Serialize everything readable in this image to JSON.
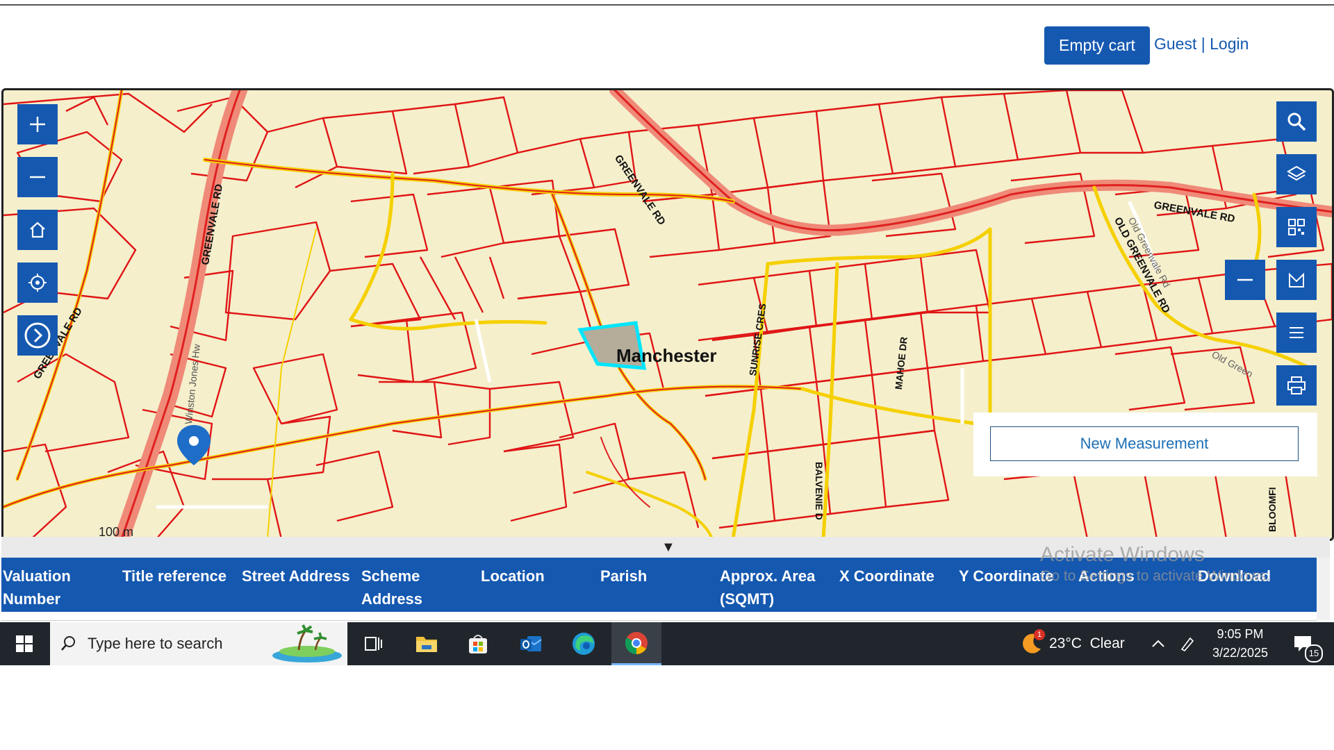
{
  "header": {
    "cart_label": "Empty cart",
    "guest_label": "Guest",
    "separator": " | ",
    "login_label": "Login"
  },
  "map": {
    "place_label": "Manchester",
    "road_labels": [
      "GREENVALE RD",
      "GREENVALE RD",
      "GREENVALE RD",
      "OLD GREENVALE RD",
      "GREENVALE RD",
      "SUNRISE CRES",
      "MAHOE DR",
      "BALVENIE D",
      "BLOOMFI",
      "Winston Jones Hw",
      "Old Greenvale Rd",
      "Old Green"
    ],
    "scale_label": "100 m",
    "tools_left": [
      "zoom-in-icon",
      "zoom-out-icon",
      "home-icon",
      "locate-icon",
      "expand-icon"
    ],
    "tools_right": [
      "search-icon",
      "layers-icon",
      "qr-icon",
      "measure-icon",
      "list-icon",
      "print-icon"
    ],
    "measure_button": "New Measurement",
    "colors": {
      "background": "#f5efcc",
      "parcel_line": "#e01515",
      "road": "#f5d000",
      "selected_parcel": "#00e5ff",
      "accent": "#1558b0"
    }
  },
  "results": {
    "toggle_icon": "▼",
    "columns": [
      "Valuation Number",
      "Title reference",
      "Street Address",
      "Scheme Address",
      "Location",
      "Parish",
      "Approx. Area (SQMT)",
      "X Coordinate",
      "Y Coordinate",
      "Actions",
      "Download"
    ]
  },
  "watermark": {
    "line1": "Activate Windows",
    "line2": "Go to Settings to activate Windows."
  },
  "taskbar": {
    "search_placeholder": "Type here to search",
    "weather": "23°C  Clear",
    "weather_badge": "1",
    "time": "9:05 PM",
    "date": "3/22/2025",
    "notification_count": "15"
  }
}
